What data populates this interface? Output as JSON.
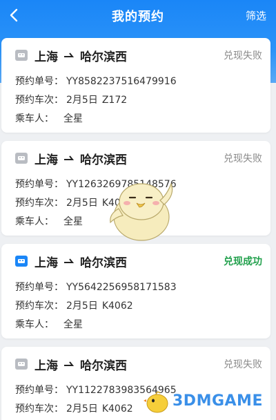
{
  "header": {
    "title": "我的预约",
    "filter_label": "筛选",
    "accent_color": "#1a86f7"
  },
  "labels": {
    "order_no": "预约单号：",
    "train_no": "预约车次：",
    "passenger": "乘车人："
  },
  "reservations": [
    {
      "from": "上海",
      "to": "哈尔滨西",
      "status": "兑现失败",
      "status_type": "failed",
      "order_no": "YY8582237516479916",
      "date": "2月5日",
      "train": "Z172",
      "passenger": "全星"
    },
    {
      "from": "上海",
      "to": "哈尔滨西",
      "status": "兑现失败",
      "status_type": "failed",
      "order_no": "YY1263269785148576",
      "date": "2月5日",
      "train": "K4062",
      "passenger": "全星"
    },
    {
      "from": "上海",
      "to": "哈尔滨西",
      "status": "兑现成功",
      "status_type": "success",
      "order_no": "YY5642256958171583",
      "date": "2月5日",
      "train": "K4062",
      "passenger": "全星"
    },
    {
      "from": "上海",
      "to": "哈尔滨西",
      "status": "兑现失败",
      "status_type": "failed",
      "order_no": "YY1122783983564965",
      "date": "2月5日",
      "train": "K4062",
      "passenger": ""
    }
  ],
  "watermark": {
    "text": "3DMGAME"
  },
  "icons": {
    "back": "chevron-left-icon",
    "train": "train-icon",
    "arrow": "one-way-arrow-icon",
    "mascot": "duck-mascot",
    "watermark_logo": "3dm-chick-logo"
  },
  "colors": {
    "failed_badge": "#b9bcc2",
    "success_badge": "#1a86f7",
    "success_text": "#21a04c",
    "failed_text": "#8a8a8a"
  }
}
